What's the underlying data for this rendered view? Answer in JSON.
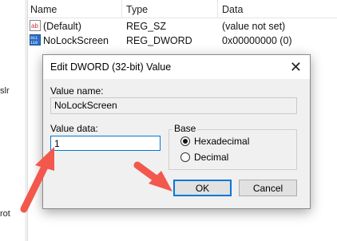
{
  "tree": {
    "fragments": [
      "slr",
      "rot"
    ]
  },
  "list": {
    "headers": [
      "Name",
      "Type",
      "Data"
    ],
    "rows": [
      {
        "name": "(Default)",
        "type": "REG_SZ",
        "data": "(value not set)",
        "icon": "string-value-icon"
      },
      {
        "name": "NoLockScreen",
        "type": "REG_DWORD",
        "data": "0x00000000 (0)",
        "icon": "binary-value-icon"
      }
    ]
  },
  "dialog": {
    "title": "Edit DWORD (32-bit) Value",
    "value_name_label": "Value name:",
    "value_name": "NoLockScreen",
    "value_data_label": "Value data:",
    "value_data": "1",
    "base_label": "Base",
    "base_options": [
      "Hexadecimal",
      "Decimal"
    ],
    "base_selected": "Hexadecimal",
    "ok_label": "OK",
    "cancel_label": "Cancel",
    "close_glyph": "✕"
  },
  "colors": {
    "arrow": "#f2584c",
    "accent": "#0078d7"
  }
}
